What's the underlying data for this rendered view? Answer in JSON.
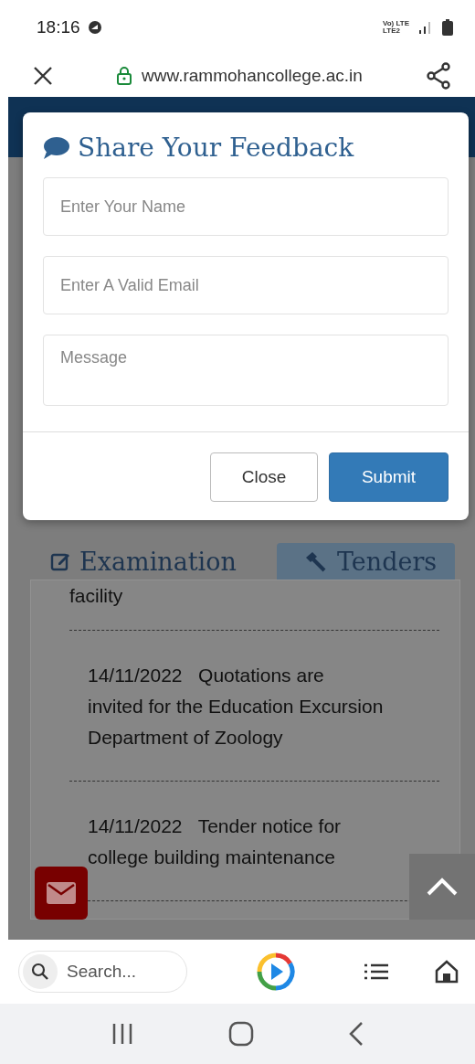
{
  "status_bar": {
    "time": "18:16",
    "network_top": "Vo) LTE",
    "network_bottom": "LTE2"
  },
  "browser": {
    "url": "www.rammohancollege.ac.in"
  },
  "modal": {
    "title": "Share Your Feedback",
    "fields": [
      {
        "kind": "input",
        "placeholder": "Enter Your Name"
      },
      {
        "kind": "input",
        "placeholder": "Enter A Valid Email"
      },
      {
        "kind": "textarea",
        "placeholder": "Message"
      }
    ],
    "buttons": [
      {
        "label": "Close",
        "kind": "secondary"
      },
      {
        "label": "Submit",
        "kind": "primary"
      }
    ]
  },
  "tabs": [
    {
      "label": "Examination",
      "selected": false
    },
    {
      "label": "Tenders",
      "selected": true
    }
  ],
  "tenders": [
    {
      "text": "facility"
    },
    {
      "date": "14/11/2022",
      "text": "Quotations are invited for the Education Excursion Department of Zoology"
    },
    {
      "date": "14/11/2022",
      "text": "Tender notice for college building maintenance"
    }
  ],
  "bottom_bar": {
    "search_placeholder": "Search..."
  }
}
